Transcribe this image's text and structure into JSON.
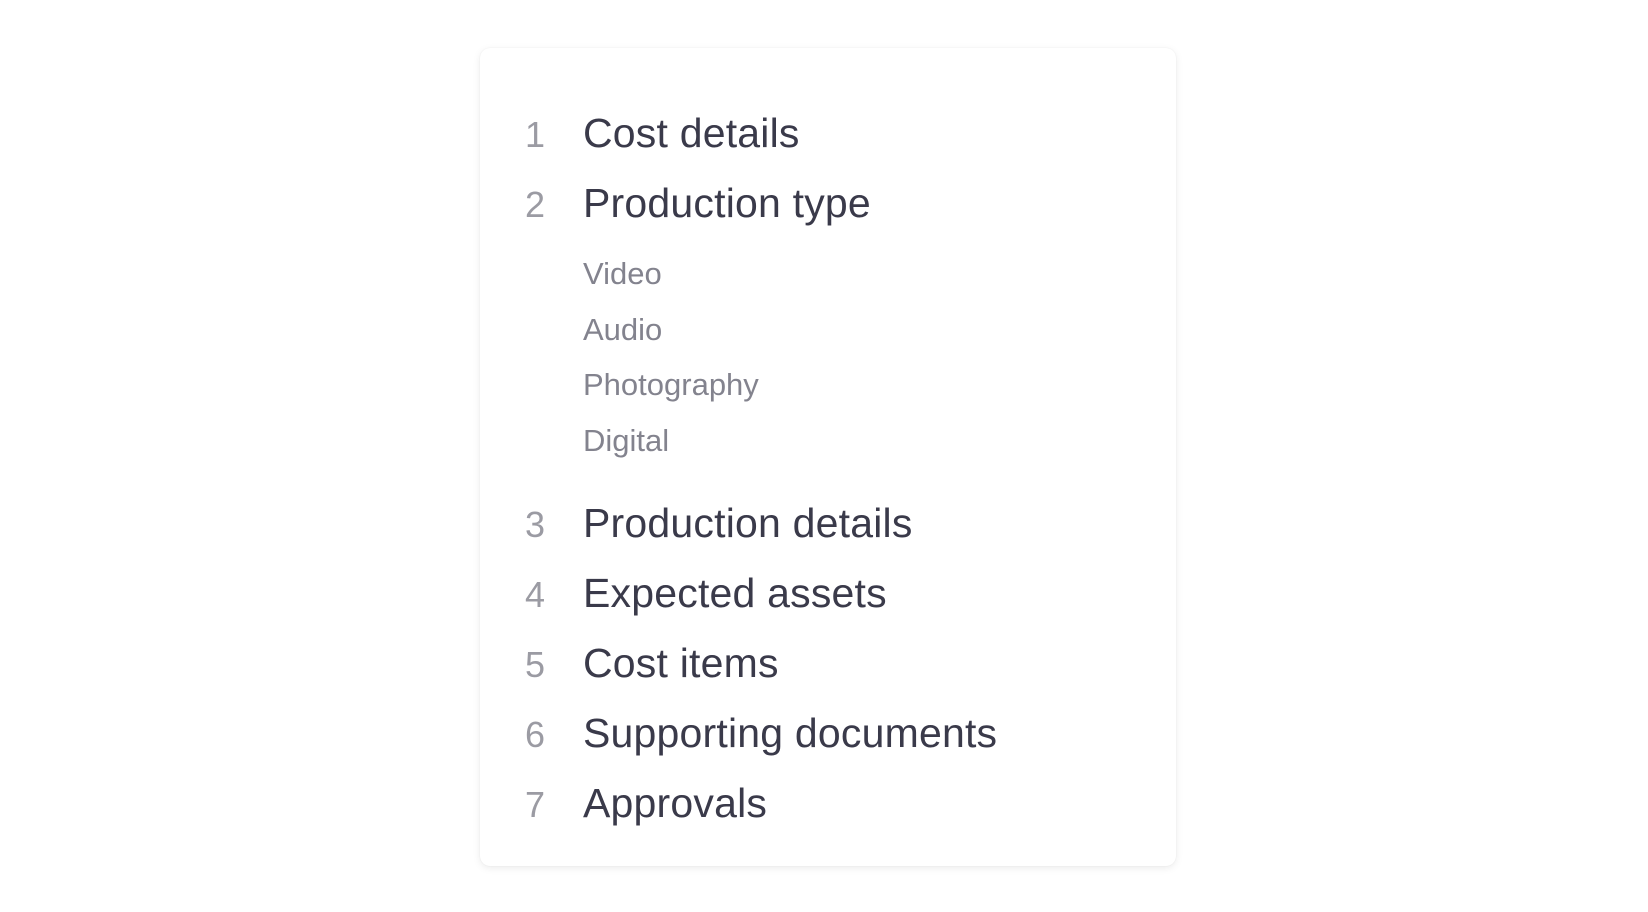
{
  "steps": [
    {
      "number": "1",
      "label": "Cost details"
    },
    {
      "number": "2",
      "label": "Production type"
    },
    {
      "number": "3",
      "label": "Production details"
    },
    {
      "number": "4",
      "label": "Expected assets"
    },
    {
      "number": "5",
      "label": "Cost items"
    },
    {
      "number": "6",
      "label": "Supporting documents"
    },
    {
      "number": "7",
      "label": "Approvals"
    }
  ],
  "substeps": [
    "Video",
    "Audio",
    "Photography",
    "Digital"
  ],
  "colors": {
    "step_label": "#3a3a4a",
    "step_number": "#9b9ba3",
    "substep_label": "#83838e",
    "card_background": "#ffffff"
  }
}
